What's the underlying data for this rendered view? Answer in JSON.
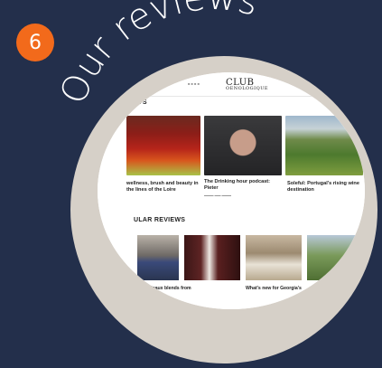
{
  "badge": "6",
  "heading": "Our reviews",
  "site": {
    "logo": "CLUB",
    "logo_sub": "OENOLOGIQUE",
    "section1": "RTS",
    "section2": "ULAR REVIEWS",
    "cards": [
      {
        "title": "wellness, brush and beauty in the lines of the Loire",
        "meta": ""
      },
      {
        "title": "The Drinking hour podcast: Pieter",
        "meta": ""
      },
      {
        "title": "Soleful: Portugal's rising wine destination",
        "meta": ""
      }
    ],
    "thumbs": [
      {
        "title": "n Bordeaux blends from"
      },
      {
        "title": ""
      },
      {
        "title": "What's new for Georgia's"
      },
      {
        "title": ""
      }
    ]
  }
}
